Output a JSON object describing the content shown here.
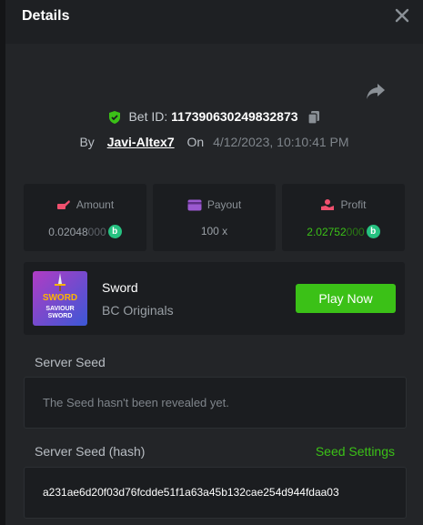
{
  "header": {
    "title": "Details"
  },
  "bet": {
    "id_label": "Bet ID:",
    "id_value": "117390630249832873",
    "by_label": "By",
    "user": "Javi-Altex7",
    "on_label": "On",
    "date": "4/12/2023, 10:10:41 PM"
  },
  "stats": {
    "amount": {
      "label": "Amount",
      "value_main": "0.02048",
      "value_trail": "000"
    },
    "payout": {
      "label": "Payout",
      "value": "100 x"
    },
    "profit": {
      "label": "Profit",
      "value_main": "2.02752",
      "value_trail": "000"
    },
    "coin_letter": "b"
  },
  "game": {
    "thumb_title": "SWORD",
    "thumb_sub": "SAVIOUR SWORD",
    "name": "Sword",
    "provider": "BC Originals",
    "play_label": "Play Now"
  },
  "seed": {
    "server_seed_label": "Server Seed",
    "server_seed_text": "The Seed hasn't been revealed yet.",
    "hash_label": "Server Seed (hash)",
    "settings_label": "Seed Settings",
    "hash_value": "a231ae6d20f03d76fcdde51f1a63a45b132cae254d944fdaa03"
  },
  "colors": {
    "accent": "#3bc117",
    "panel": "#232528",
    "card": "#1b1d20"
  }
}
